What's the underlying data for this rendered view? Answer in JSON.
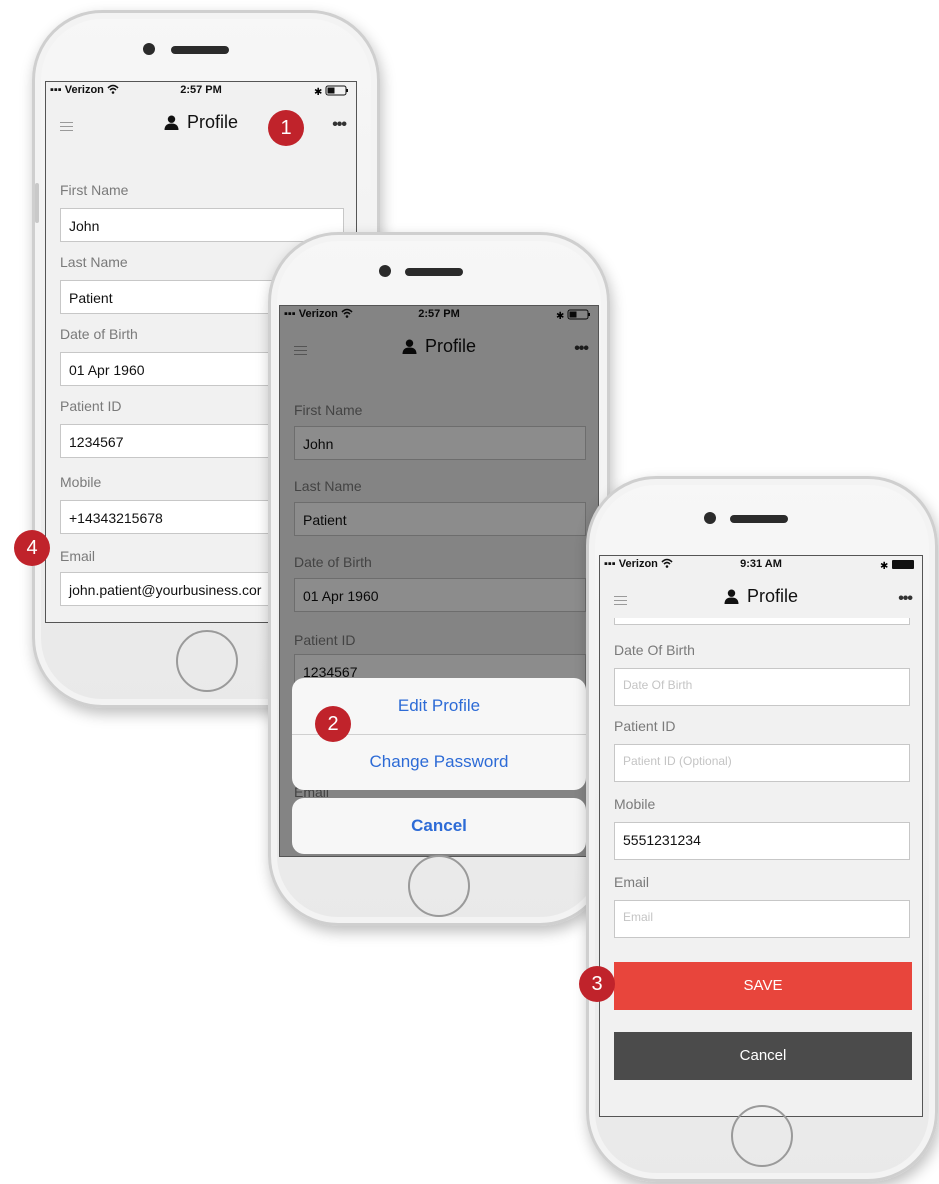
{
  "phone1": {
    "status": {
      "carrier": "Verizon",
      "time": "2:57 PM"
    },
    "title": "Profile",
    "more": "•••",
    "fields": [
      {
        "label": "First Name",
        "value": "John"
      },
      {
        "label": "Last Name",
        "value": "Patient"
      },
      {
        "label": "Date of Birth",
        "value": "01 Apr 1960"
      },
      {
        "label": "Patient ID",
        "value": "1234567"
      },
      {
        "label": "Mobile",
        "value": "+14343215678"
      },
      {
        "label": "Email",
        "value": "john.patient@yourbusiness.cor"
      }
    ]
  },
  "phone2": {
    "status": {
      "carrier": "Verizon",
      "time": "2:57 PM"
    },
    "title": "Profile",
    "more": "•••",
    "fields": [
      {
        "label": "First Name",
        "value": "John"
      },
      {
        "label": "Last Name",
        "value": "Patient"
      },
      {
        "label": "Date of Birth",
        "value": "01 Apr 1960"
      },
      {
        "label": "Patient ID",
        "value": "1234567"
      }
    ],
    "hidden_label": "Email",
    "sheet": {
      "edit": "Edit Profile",
      "change_password": "Change Password",
      "cancel": "Cancel"
    }
  },
  "phone3": {
    "status": {
      "carrier": "Verizon",
      "time": "9:31 AM"
    },
    "title": "Profile",
    "more": "•••",
    "fields": [
      {
        "label": "Date Of Birth",
        "placeholder": "Date Of Birth",
        "value": ""
      },
      {
        "label": "Patient ID",
        "placeholder": "Patient ID (Optional)",
        "value": ""
      },
      {
        "label": "Mobile",
        "placeholder": "",
        "value": "5551231234"
      },
      {
        "label": "Email",
        "placeholder": "Email",
        "value": ""
      }
    ],
    "save": "SAVE",
    "cancel": "Cancel"
  },
  "badges": {
    "b1": "1",
    "b2": "2",
    "b3": "3",
    "b4": "4"
  },
  "colors": {
    "badge": "#c0232b",
    "save": "#e8453c",
    "cancel": "#4b4b4b",
    "link": "#2d6bd6"
  },
  "icons": {
    "menu": "hamburger-icon",
    "person": "person-icon",
    "more": "more-icon",
    "wifi": "wifi-icon",
    "battery": "battery-icon",
    "bluetooth": "bluetooth-icon"
  }
}
